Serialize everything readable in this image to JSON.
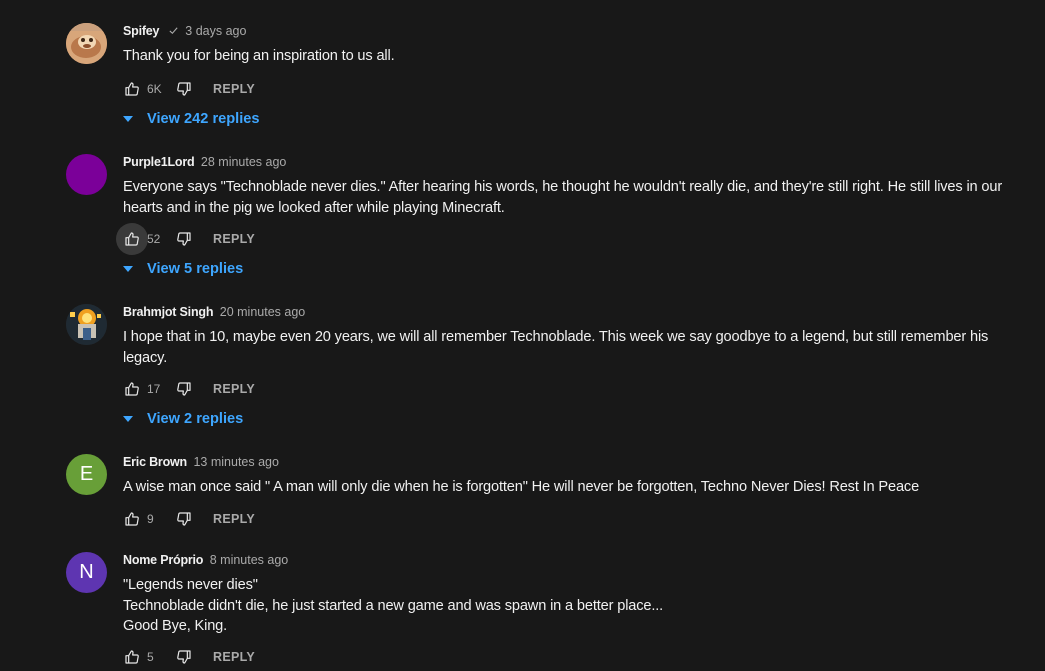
{
  "comments": [
    {
      "author": "Spifey",
      "verified": true,
      "time": "3 days ago",
      "text": "Thank you for being an inspiration to us all.",
      "likes": "6K",
      "reply_label": "REPLY",
      "view_replies": "View 242 replies",
      "avatar": {
        "type": "image",
        "color": "#c9966b"
      }
    },
    {
      "author": "Purple1Lord",
      "verified": false,
      "time": "28 minutes ago",
      "text": "Everyone says \"Technoblade never dies.\" After hearing his words, he thought he wouldn't really die, and they're still right. He still lives in our hearts and in the pig we looked after while playing Minecraft.",
      "likes": "52",
      "reply_label": "REPLY",
      "view_replies": "View 5 replies",
      "avatar": {
        "type": "solid",
        "color": "#7b0099"
      }
    },
    {
      "author": "Brahmjot Singh",
      "verified": false,
      "time": "20 minutes ago",
      "text": "I hope that in 10, maybe even 20 years, we will all remember Technoblade. This week we say goodbye to a legend, but still remember his legacy.",
      "likes": "17",
      "reply_label": "REPLY",
      "view_replies": "View 2 replies",
      "avatar": {
        "type": "image",
        "color": "#2b2b2b"
      }
    },
    {
      "author": "Eric Brown",
      "verified": false,
      "time": "13 minutes ago",
      "text": "A wise man once said \" A man will only die when he is forgotten\" He will never be forgotten, Techno Never Dies! Rest In Peace",
      "likes": "9",
      "reply_label": "REPLY",
      "avatar": {
        "type": "letter",
        "letter": "E",
        "color": "#689f38"
      }
    },
    {
      "author": "Nome Próprio",
      "verified": false,
      "time": "8 minutes ago",
      "text": "\"Legends never dies\"\nTechnoblade didn't die, he just started a new game and was spawn in a better place...\nGood Bye, King.",
      "likes": "5",
      "reply_label": "REPLY",
      "avatar": {
        "type": "letter",
        "letter": "N",
        "color": "#5e35b1"
      }
    }
  ],
  "colors": {
    "background": "#181818",
    "link": "#3ea6ff",
    "secondary_text": "#aaaaaa"
  },
  "icons": [
    "thumbs-up-icon",
    "thumbs-down-icon",
    "chevron-down-icon",
    "verified-check-icon"
  ]
}
